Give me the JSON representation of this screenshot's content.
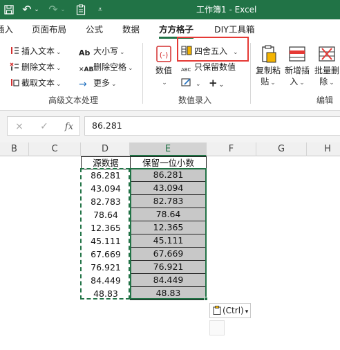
{
  "titlebar": {
    "title": "工作簿1  -  Excel",
    "quick_access": [
      {
        "icon": "save-icon",
        "glyph": "🖫"
      },
      {
        "icon": "undo-icon",
        "glyph": "↶"
      },
      {
        "icon": "undo-dropdown-icon",
        "glyph": "⌄"
      },
      {
        "icon": "redo-icon",
        "glyph": "↷"
      },
      {
        "icon": "redo-dropdown-icon",
        "glyph": "⌄"
      },
      {
        "icon": "clipboard-icon",
        "glyph": "📋"
      },
      {
        "icon": "customize-toolbar-icon",
        "glyph": "⩡"
      }
    ]
  },
  "tabs": {
    "items": [
      {
        "label": "插入"
      },
      {
        "label": "页面布局"
      },
      {
        "label": "公式"
      },
      {
        "label": "数据"
      },
      {
        "label": "方方格子",
        "active": true
      },
      {
        "label": "DIY工具箱"
      }
    ]
  },
  "ribbon": {
    "text_group": {
      "insert_text": "插入文本",
      "delete_text": "删除文本",
      "extract_text": "截取文本",
      "case": "大小写",
      "delete_spaces": "删除空格",
      "more": "更多",
      "label": "高级文本处理"
    },
    "numeric_group": {
      "numeric_button": "数值",
      "round": "四舍五入",
      "keep_numeric": "只保留数值",
      "label": "数值录入"
    },
    "edit_group": {
      "copy_paste": [
        "复制粘",
        "贴"
      ],
      "add_insert": [
        "新增插",
        "入"
      ],
      "batch_delete": [
        "批量删",
        "除"
      ],
      "label": "编辑"
    }
  },
  "formula_bar": {
    "cancel": "×",
    "confirm": "✓",
    "fx": "fx",
    "value": "86.281"
  },
  "sheet": {
    "columns": [
      "B",
      "C",
      "D",
      "E",
      "F",
      "G",
      "H"
    ],
    "selected_column": "E",
    "header_d": "源数据",
    "header_e": "保留一位小数",
    "source_values": [
      "86.281",
      "43.094",
      "82.783",
      "78.64",
      "12.365",
      "45.111",
      "67.669",
      "76.921",
      "84.449",
      "48.83"
    ],
    "result_values": [
      "86.281",
      "43.094",
      "82.783",
      "78.64",
      "12.365",
      "45.111",
      "67.669",
      "76.921",
      "84.449",
      "48.83"
    ]
  },
  "paste_options": {
    "label": "(Ctrl)",
    "caret": "▾"
  },
  "colors": {
    "accent": "#217346",
    "highlight": "#e53935",
    "selection_fill": "#c8c8c8"
  }
}
